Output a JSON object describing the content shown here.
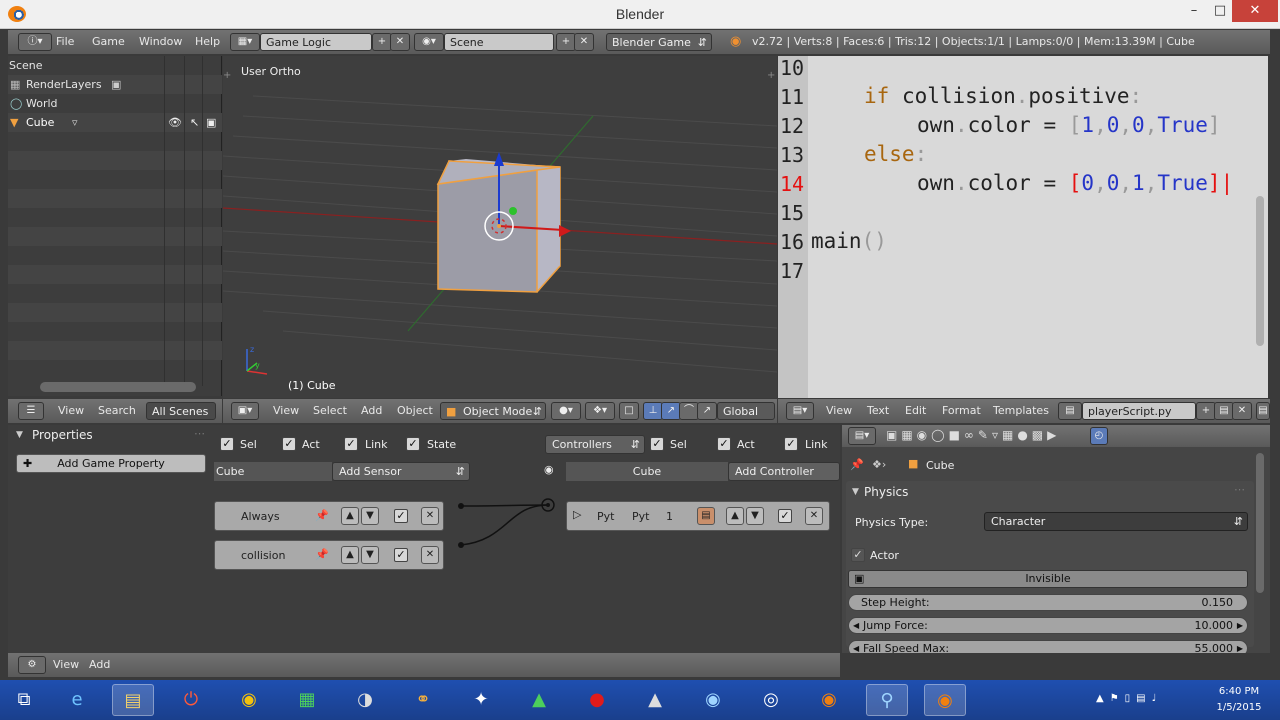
{
  "window": {
    "title": "Blender",
    "min": "–",
    "max": "□",
    "close": "✕"
  },
  "info_header": {
    "menus": [
      "File",
      "Game",
      "Window",
      "Help"
    ],
    "screen_layout": "Game Logic",
    "scene": "Scene",
    "engine": "Blender Game",
    "stats": "v2.72 | Verts:8 | Faces:6 | Tris:12 | Objects:1/1 | Lamps:0/0 | Mem:13.39M | Cube"
  },
  "outliner": {
    "items": [
      {
        "label": "Scene"
      },
      {
        "label": "RenderLayers"
      },
      {
        "label": "World"
      },
      {
        "label": "Cube"
      }
    ],
    "header": {
      "view": "View",
      "search": "Search",
      "filter": "All Scenes"
    }
  },
  "viewport": {
    "view_name": "User Ortho",
    "object_label": "(1) Cube",
    "header": {
      "view": "View",
      "select": "Select",
      "add": "Add",
      "object": "Object",
      "mode": "Object Mode",
      "orientation": "Global"
    }
  },
  "text_editor": {
    "lines": [
      {
        "n": "10"
      },
      {
        "n": "11"
      },
      {
        "n": "12"
      },
      {
        "n": "13"
      },
      {
        "n": "14"
      },
      {
        "n": "15"
      },
      {
        "n": "16"
      },
      {
        "n": "17"
      }
    ],
    "code": {
      "l11a": "if",
      "l11b": " collision",
      "l11c": ".",
      "l11d": "positive",
      "l11e": ":",
      "l12a": "own",
      "l12b": ".",
      "l12c": "color",
      "l12d": " = ",
      "l12e": "[",
      "l12f": "1",
      "l12g": ",",
      "l12h": "0",
      "l12i": ",",
      "l12j": "0",
      "l12k": ",",
      "l12l": "True",
      "l12m": "]",
      "l13a": "else",
      "l13b": ":",
      "l14a": "own",
      "l14b": ".",
      "l14c": "color",
      "l14d": " = ",
      "l14e": "[",
      "l14f": "0",
      "l14g": ",",
      "l14h": "0",
      "l14i": ",",
      "l14j": "1",
      "l14k": ",",
      "l14l": "True",
      "l14m": "]",
      "l16a": "main",
      "l16b": "()"
    },
    "header": {
      "view": "View",
      "text": "Text",
      "edit": "Edit",
      "format": "Format",
      "templates": "Templates",
      "file": "playerScript.py"
    }
  },
  "logic": {
    "properties_title": "Properties",
    "add_game_property": "Add Game Property",
    "sensors_header": {
      "sel": "Sel",
      "act": "Act",
      "link": "Link",
      "state": "State"
    },
    "sensor_object": "Cube",
    "add_sensor": "Add Sensor",
    "sensors": [
      {
        "name": "Always"
      },
      {
        "name": "collision"
      }
    ],
    "controllers_dropdown": "Controllers",
    "ctrl_header": {
      "sel": "Sel",
      "act": "Act",
      "link": "Link"
    },
    "ctrl_object": "Cube",
    "add_controller": "Add Controller",
    "controller": {
      "type": "Pyt",
      "script": "Pyt",
      "state": "1"
    },
    "footer": {
      "view": "View",
      "add": "Add"
    }
  },
  "properties": {
    "breadcrumb_object": "Cube",
    "panel_title": "Physics",
    "physics_type_label": "Physics Type:",
    "physics_type_value": "Character",
    "actor_label": "Actor",
    "invisible_label": "Invisible",
    "step_height_label": "Step Height:",
    "step_height_value": "0.150",
    "jump_force_label": "Jump Force:",
    "jump_force_value": "10.000",
    "fall_speed_label": "Fall Speed Max:",
    "fall_speed_value": "55.000"
  },
  "taskbar": {
    "time": "6:40 PM",
    "date": "1/5/2015"
  }
}
